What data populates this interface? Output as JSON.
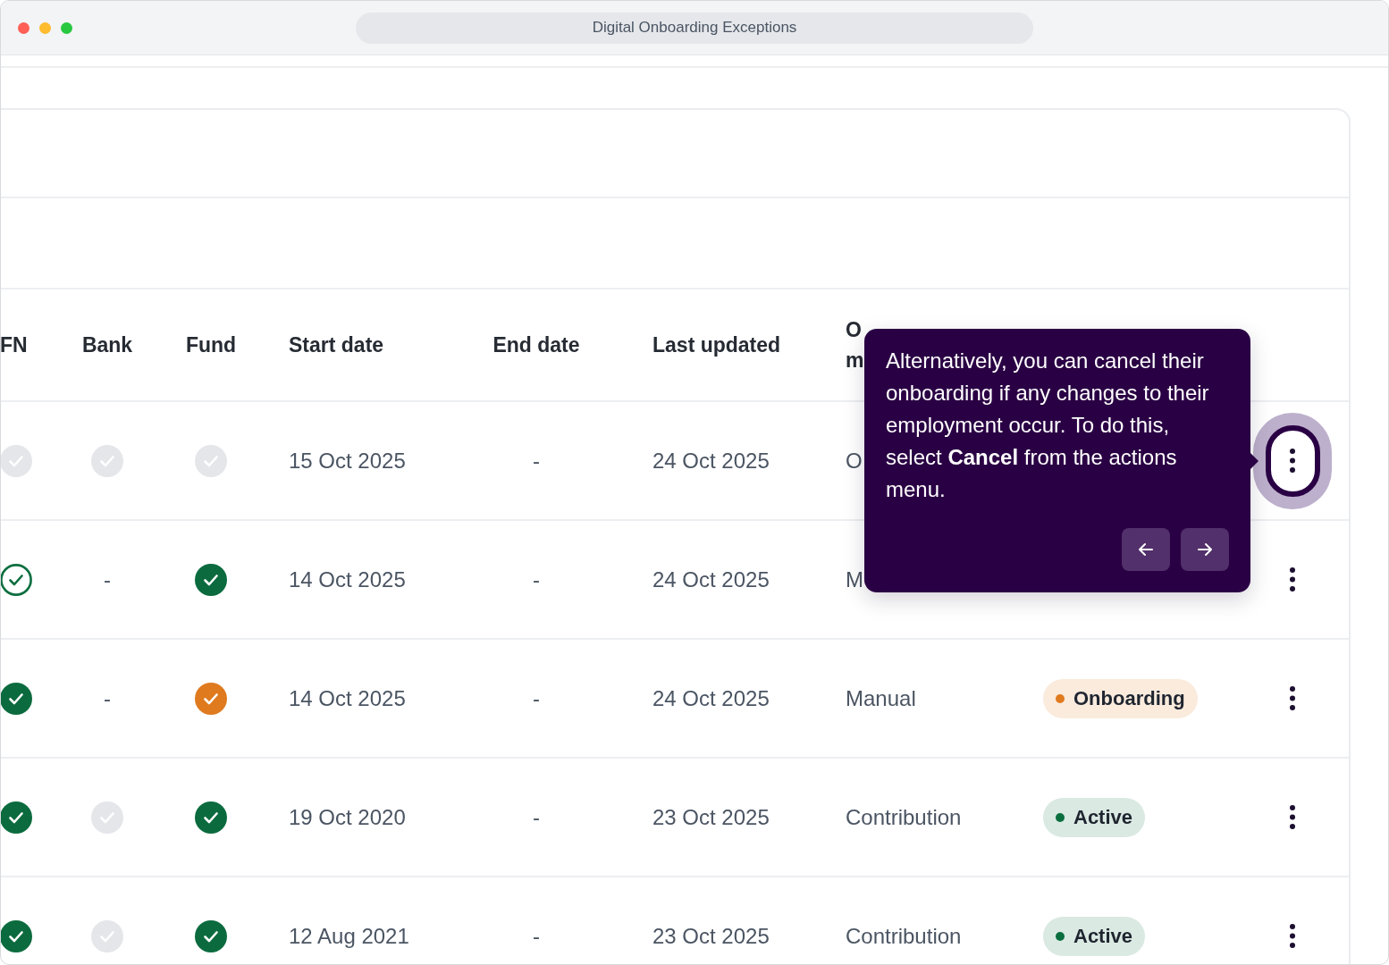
{
  "window": {
    "title": "Digital Onboarding Exceptions"
  },
  "table": {
    "columns": [
      {
        "label": "FN"
      },
      {
        "label": "Bank"
      },
      {
        "label": "Fund"
      },
      {
        "label": "Start date"
      },
      {
        "label": "End date"
      },
      {
        "label": "Last updated"
      },
      {
        "label": "O m"
      }
    ],
    "rows": [
      {
        "cells": [
          {
            "kind": "pending"
          },
          {
            "kind": "pending"
          },
          {
            "kind": "pending"
          },
          {
            "kind": "text",
            "text": "15 Oct 2025"
          },
          {
            "kind": "text",
            "text": "-"
          },
          {
            "kind": "text",
            "text": "24 Oct 2025"
          },
          {
            "kind": "text",
            "text": "O"
          }
        ],
        "actions_highlighted": true
      },
      {
        "cells": [
          {
            "kind": "partial"
          },
          {
            "kind": "text",
            "text": "-"
          },
          {
            "kind": "complete"
          },
          {
            "kind": "text",
            "text": "14 Oct 2025"
          },
          {
            "kind": "text",
            "text": "-"
          },
          {
            "kind": "text",
            "text": "24 Oct 2025"
          },
          {
            "kind": "text",
            "text": "M"
          }
        ],
        "actions_highlighted": false
      },
      {
        "cells": [
          {
            "kind": "complete"
          },
          {
            "kind": "text",
            "text": "-"
          },
          {
            "kind": "warning"
          },
          {
            "kind": "text",
            "text": "14 Oct 2025"
          },
          {
            "kind": "text",
            "text": "-"
          },
          {
            "kind": "text",
            "text": "24 Oct 2025"
          },
          {
            "kind": "text",
            "text": "Manual"
          }
        ],
        "status": {
          "label": "Onboarding",
          "color": "#e07a1f"
        },
        "actions_highlighted": false
      },
      {
        "cells": [
          {
            "kind": "complete"
          },
          {
            "kind": "pending"
          },
          {
            "kind": "complete"
          },
          {
            "kind": "text",
            "text": "19 Oct 2020"
          },
          {
            "kind": "text",
            "text": "-"
          },
          {
            "kind": "text",
            "text": "23 Oct 2025"
          },
          {
            "kind": "text",
            "text": "Contribution"
          }
        ],
        "status": {
          "label": "Active",
          "color": "#0b6e3f"
        },
        "actions_highlighted": false
      },
      {
        "cells": [
          {
            "kind": "complete"
          },
          {
            "kind": "pending"
          },
          {
            "kind": "complete"
          },
          {
            "kind": "text",
            "text": "12 Aug 2021"
          },
          {
            "kind": "text",
            "text": "-"
          },
          {
            "kind": "text",
            "text": "23 Oct 2025"
          },
          {
            "kind": "text",
            "text": "Contribution"
          }
        ],
        "status": {
          "label": "Active",
          "color": "#0b6e3f"
        },
        "actions_highlighted": false
      }
    ]
  },
  "tour_tooltip": {
    "text": "Alternatively, you can cancel their onboarding if any changes to their employment occur. To do this, select **Cancel** from the actions menu.",
    "buttons": [
      {
        "kind": "previous"
      },
      {
        "kind": "next"
      }
    ]
  }
}
